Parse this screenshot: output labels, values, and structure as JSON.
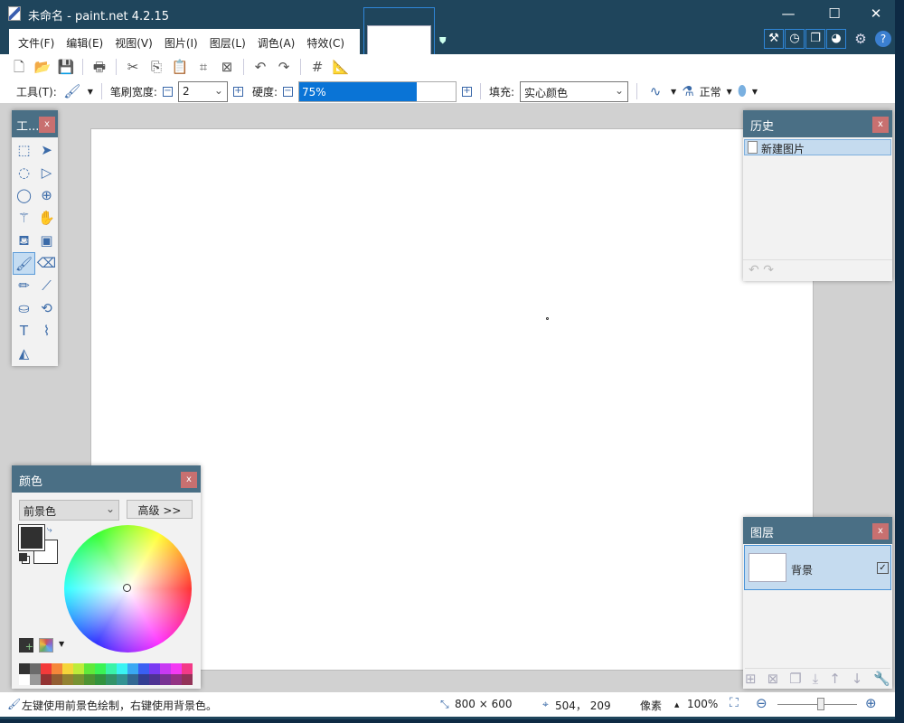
{
  "window": {
    "title": "未命名 - paint.net 4.2.15",
    "minimize": "—",
    "maximize": "☐",
    "close": "✕"
  },
  "menu": [
    "文件(F)",
    "编辑(E)",
    "视图(V)",
    "图片(I)",
    "图层(L)",
    "调色(A)",
    "特效(C)"
  ],
  "right_icons": [
    {
      "name": "tools-window-icon",
      "glyph": "⚒"
    },
    {
      "name": "history-window-icon",
      "glyph": "◷"
    },
    {
      "name": "layers-window-icon",
      "glyph": "❐"
    },
    {
      "name": "colors-window-icon",
      "glyph": "◕"
    }
  ],
  "settings_glyph": "⚙",
  "help_glyph": "?",
  "toolbar1": [
    {
      "name": "new-icon",
      "g": "🗋"
    },
    {
      "name": "open-icon",
      "g": "📂"
    },
    {
      "name": "save-icon",
      "g": "💾"
    },
    {
      "sep": true
    },
    {
      "name": "print-icon",
      "g": "🖶"
    },
    {
      "sep": true
    },
    {
      "name": "cut-icon",
      "g": "✂"
    },
    {
      "name": "copy-icon",
      "g": "⎘"
    },
    {
      "name": "paste-icon",
      "g": "📋"
    },
    {
      "name": "crop-icon",
      "g": "⌗"
    },
    {
      "name": "deselect-icon",
      "g": "⊠"
    },
    {
      "sep": true
    },
    {
      "name": "undo-icon",
      "g": "↶"
    },
    {
      "name": "redo-icon",
      "g": "↷"
    },
    {
      "sep": true
    },
    {
      "name": "grid-icon",
      "g": "#"
    },
    {
      "name": "ruler-icon",
      "g": "📐"
    }
  ],
  "toolbar2": {
    "tool_label": "工具(T):",
    "brush_width_label": "笔刷宽度:",
    "brush_width": "2",
    "hardness_label": "硬度:",
    "hardness": "75%",
    "hardness_value": 75,
    "fill_label": "填充:",
    "fill": "实心颜色",
    "blend": "正常"
  },
  "tools_panel": {
    "title": "工...",
    "close": "x",
    "tools": [
      {
        "name": "rectangle-select-icon",
        "g": "⬚"
      },
      {
        "name": "move-selected-icon",
        "g": "➤"
      },
      {
        "name": "lasso-select-icon",
        "g": "◌"
      },
      {
        "name": "move-selection-icon",
        "g": "▷"
      },
      {
        "name": "ellipse-select-icon",
        "g": "◯"
      },
      {
        "name": "zoom-icon",
        "g": "⊕"
      },
      {
        "name": "magic-wand-icon",
        "g": "⚚"
      },
      {
        "name": "pan-icon",
        "g": "✋"
      },
      {
        "name": "paint-bucket-icon",
        "g": "⛾"
      },
      {
        "name": "gradient-icon",
        "g": "▣"
      },
      {
        "name": "paintbrush-icon",
        "g": "🖌",
        "sel": true
      },
      {
        "name": "eraser-icon",
        "g": "⌫"
      },
      {
        "name": "pencil-icon",
        "g": "✏"
      },
      {
        "name": "color-picker-icon",
        "g": "⟋"
      },
      {
        "name": "clone-stamp-icon",
        "g": "⛀"
      },
      {
        "name": "recolor-icon",
        "g": "⟲"
      },
      {
        "name": "text-icon",
        "g": "T"
      },
      {
        "name": "line-curve-icon",
        "g": "⌇"
      },
      {
        "name": "shapes-icon",
        "g": "◭"
      }
    ]
  },
  "history": {
    "title": "历史",
    "close": "x",
    "items": [
      "新建图片"
    ],
    "undo": "↶",
    "redo": "↷"
  },
  "colors": {
    "title": "颜色",
    "close": "x",
    "mode": "前景色",
    "advanced": "高级 >>",
    "primary": "#303030",
    "secondary": "#ffffff",
    "palette": [
      "#333333",
      "#6b6b6b",
      "#f33a3a",
      "#f5873a",
      "#f5d53a",
      "#bdec3a",
      "#5fe93a",
      "#3af354",
      "#3af3a8",
      "#3af3f3",
      "#3aa8f3",
      "#3a5ff3",
      "#7a3af3",
      "#c83af3",
      "#f33af3",
      "#f33a88",
      "#ffffff",
      "#999999",
      "#933333",
      "#935e33",
      "#938333",
      "#779333",
      "#4e9333",
      "#33933e",
      "#339368",
      "#339393",
      "#336893",
      "#333e93",
      "#4e3393",
      "#783393",
      "#933383",
      "#933358"
    ]
  },
  "layers": {
    "title": "图层",
    "close": "x",
    "items": [
      {
        "name": "背景",
        "visible": true
      }
    ],
    "buttons": [
      {
        "name": "add-layer-icon",
        "g": "⊞"
      },
      {
        "name": "delete-layer-icon",
        "g": "⊠"
      },
      {
        "name": "duplicate-layer-icon",
        "g": "❐"
      },
      {
        "name": "merge-down-icon",
        "g": "⤓"
      },
      {
        "name": "move-up-icon",
        "g": "↑"
      },
      {
        "name": "move-down-icon",
        "g": "↓"
      },
      {
        "name": "layer-properties-icon",
        "g": "🔧"
      }
    ]
  },
  "status": {
    "hint": "左键使用前景色绘制，右键使用背景色。",
    "image_size": "800 × 600",
    "cursor": "504， 209",
    "unit": "像素",
    "zoom": "100%",
    "zoom_level": 100
  }
}
